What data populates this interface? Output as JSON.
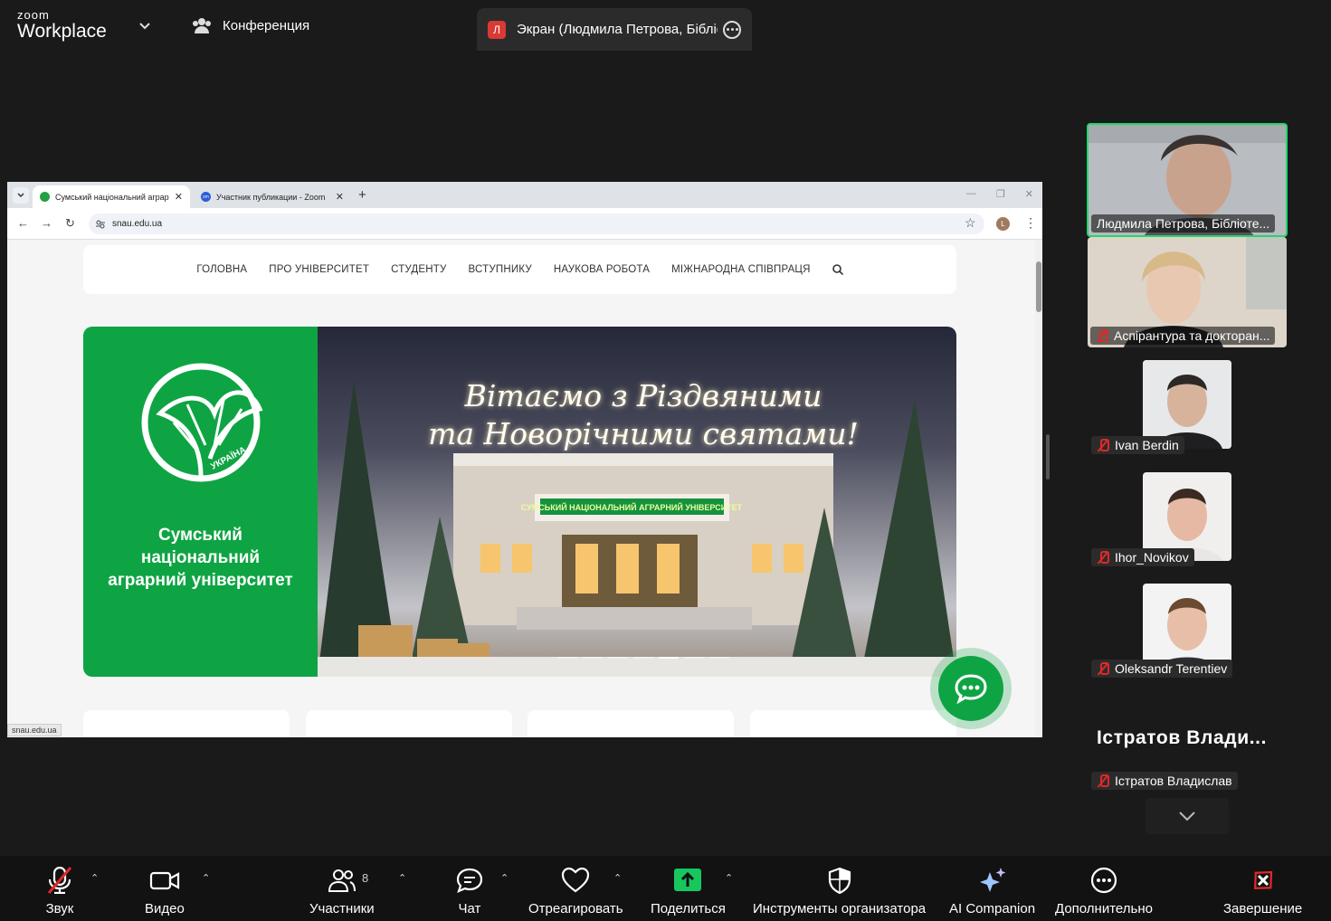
{
  "app": {
    "logo_top": "zoom",
    "logo_bottom": "Workplace"
  },
  "topbar": {
    "meeting_label": "Конференция",
    "screen_tab": {
      "avatar_letter": "Л",
      "title": "Экран (Людмила Петрова, Бібліотека"
    }
  },
  "browser": {
    "tabs": [
      {
        "title": "Сумський національний аграрний університет",
        "active": true
      },
      {
        "title": "Участник публикации - Zoom",
        "active": false
      }
    ],
    "url": "snau.edu.ua",
    "profile_letter": "L",
    "status_url": "snau.edu.ua"
  },
  "website": {
    "nav": [
      "ГОЛОВНА",
      "ПРО УНІВЕРСИТЕТ",
      "СТУДЕНТУ",
      "ВСТУПНИКУ",
      "НАУКОВА РОБОТА",
      "МІЖНАРОДНА СПІВПРАЦЯ"
    ],
    "logo_text": "УКРАЇНА",
    "university_name": [
      "Сумський",
      "національний",
      "аграрний університет"
    ],
    "greeting": [
      "Вітаємо з Різдвяними",
      "та Новорічними святами!"
    ],
    "building_sign": "СУМСЬКИЙ НАЦІОНАЛЬНИЙ АГРАРНИЙ УНІВЕРСИТЕТ",
    "carousel_active": 5
  },
  "participants": [
    {
      "name": "Людмила Петрова, Бібліоте...",
      "muted": false,
      "active_speaker": true
    },
    {
      "name": "Аспірантура та докторан...",
      "muted": true
    },
    {
      "name": "Ivan Berdin",
      "muted": true
    },
    {
      "name": "Ihor_Novikov",
      "muted": true
    },
    {
      "name": "Oleksandr Terentiev",
      "muted": true
    },
    {
      "name": "Істратов Владислав",
      "muted": true,
      "display_name": "Істратов  Влади..."
    }
  ],
  "toolbar": {
    "audio": "Звук",
    "video": "Видео",
    "participants": "Участники",
    "participants_count": "8",
    "chat": "Чат",
    "react": "Отреагировать",
    "share": "Поделиться",
    "host_tools": "Инструменты организатора",
    "ai": "AI Companion",
    "more": "Дополнительно",
    "end": "Завершение"
  },
  "colors": {
    "accent_green": "#0fa443",
    "share_green": "#17c75e",
    "end_red": "#e02828",
    "speaker_border": "#22d66b"
  }
}
